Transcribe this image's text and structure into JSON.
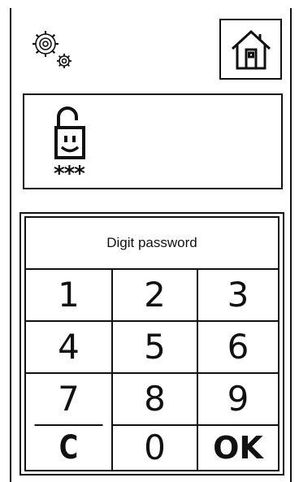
{
  "icons": {
    "settings": "gears-icon",
    "home": "home-icon",
    "lock": "unlocked-smiley-lock-icon"
  },
  "status": {
    "password_mask": "***"
  },
  "keypad": {
    "prompt": "Digit password",
    "keys": [
      [
        "1",
        "2",
        "3"
      ],
      [
        "4",
        "5",
        "6"
      ],
      [
        "7",
        "8",
        "9"
      ],
      [
        "C",
        "0",
        "OK"
      ]
    ]
  }
}
